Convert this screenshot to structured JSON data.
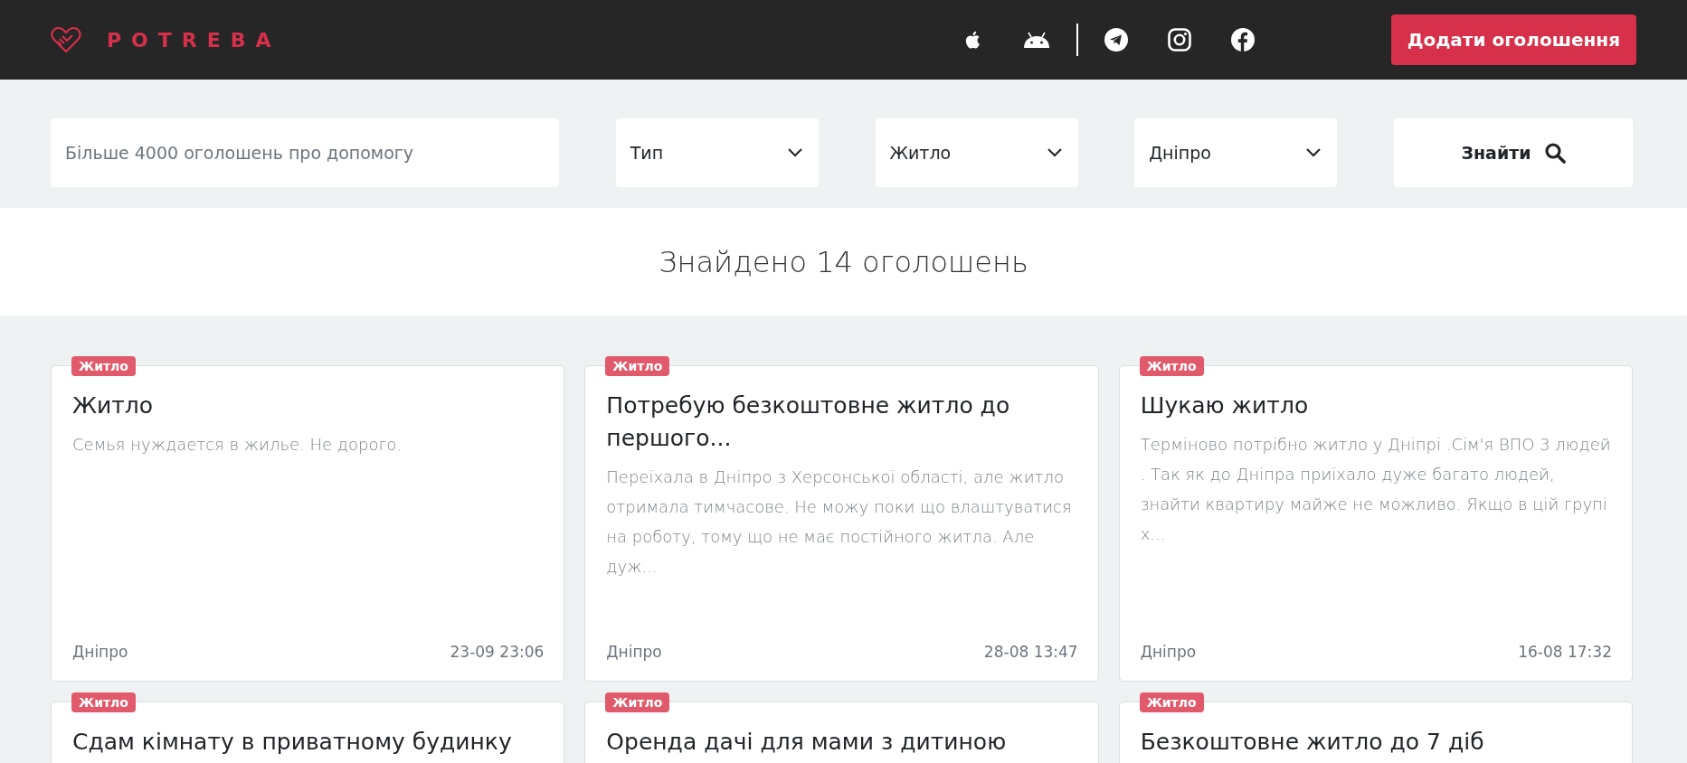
{
  "header": {
    "logo": "POTREBA",
    "add_button": "Додати оголошення"
  },
  "search": {
    "placeholder": "Більше 4000 оголошень про допомогу",
    "selects": [
      "Тип",
      "Житло",
      "Дніпро"
    ],
    "button": "Знайти"
  },
  "results_title": "Знайдено 14 оголошень",
  "cards": [
    {
      "tag": "Житло",
      "title": "Житло",
      "text": "Семья нуждается в жилье. Не дорого.",
      "city": "Дніпро",
      "date": "23-09 23:06"
    },
    {
      "tag": "Житло",
      "title": "Потребую безкоштовне житло до першого...",
      "text": "Переїхала в Дніпро з Херсонської області, але житло отримала тимчасове. Не можу поки що влаштуватися на роботу, тому що не має постійного житла. Але дуж...",
      "city": "Дніпро",
      "date": "28-08 13:47"
    },
    {
      "tag": "Житло",
      "title": "Шукаю житло",
      "text": "Терміново потрібно житло у Дніпрі .Сім'я ВПО 3 людей . Так як до Дніпра приїхало дуже багато людей, знайти квартиру майже не можливо. Якщо в цій групі х...",
      "city": "Дніпро",
      "date": "16-08 17:32"
    },
    {
      "tag": "Житло",
      "title": "Сдам кімнату в приватному будинку"
    },
    {
      "tag": "Житло",
      "title": "Оренда дачі для мами з дитиною"
    },
    {
      "tag": "Житло",
      "title": "Безкоштовне житло до 7 діб"
    }
  ]
}
